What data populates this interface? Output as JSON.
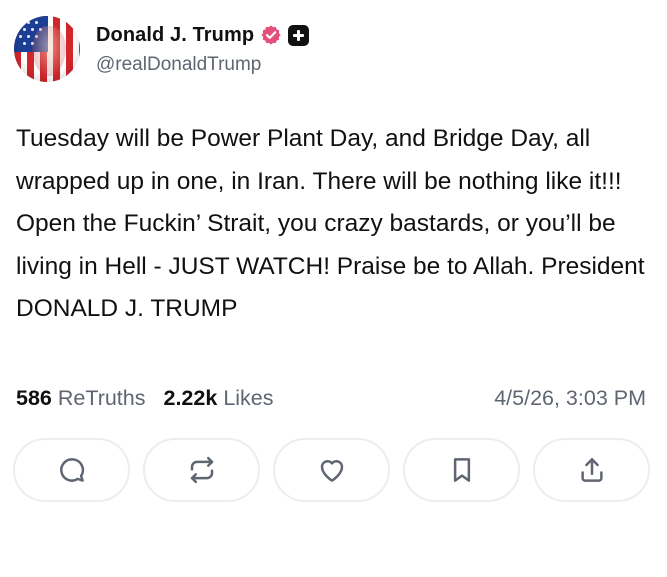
{
  "author": {
    "display_name": "Donald J. Trump",
    "handle": "@realDonaldTrump",
    "avatar_icon": "flag-portrait-avatar",
    "verified_icon": "verified-badge-icon",
    "badge_icon": "plus-badge-icon"
  },
  "post": {
    "text": "Tuesday will be Power Plant Day, and Bridge Day, all wrapped up in one, in Iran. There will be nothing like it!!! Open the Fuckin’ Strait, you crazy bastards, or you’ll be living in Hell - JUST WATCH! Praise be to Allah. President DONALD J. TRUMP"
  },
  "stats": {
    "retruths_count": "586",
    "retruths_label": "ReTruths",
    "likes_count": "2.22k",
    "likes_label": "Likes",
    "timestamp": "4/5/26, 3:03 PM"
  },
  "actions": [
    {
      "name": "reply",
      "icon": "comment-icon"
    },
    {
      "name": "retruth",
      "icon": "repost-icon"
    },
    {
      "name": "like",
      "icon": "heart-icon"
    },
    {
      "name": "bookmark",
      "icon": "bookmark-icon"
    },
    {
      "name": "share",
      "icon": "share-icon"
    }
  ],
  "colors": {
    "text_primary": "#111111",
    "text_secondary": "#5f6672",
    "verified_badge": "#e4507c",
    "button_border": "#ebedf0",
    "icon_color": "#5f6672"
  }
}
